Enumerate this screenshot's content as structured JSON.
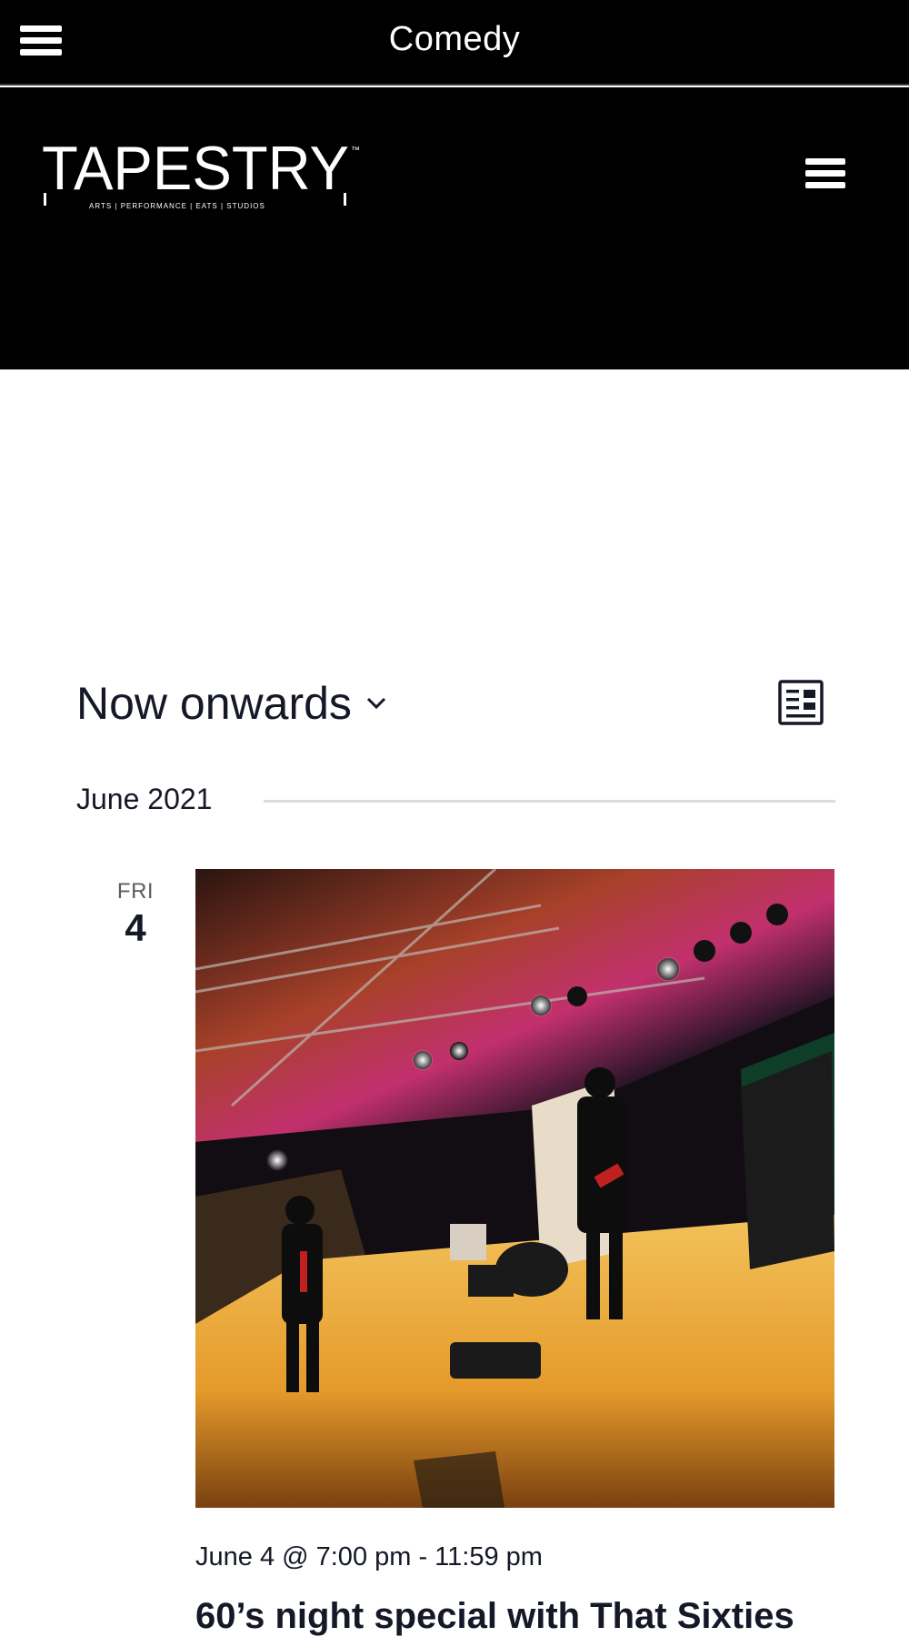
{
  "topbar": {
    "title": "Comedy"
  },
  "header": {
    "logo_text": "TAPESTRY",
    "logo_tagline": "ARTS | PERFORMANCE | EATS | STUDIOS",
    "logo_tm": "™"
  },
  "events_bar": {
    "date_selector_label": "Now onwards",
    "chevron_icon": "chevron-down-icon",
    "view_icon": "list-view-icon"
  },
  "month_separator": {
    "label": "June 2021"
  },
  "event": {
    "day_of_week": "FRI",
    "day_number": "4",
    "time": "June 4 @ 7:00 pm - 11:59 pm",
    "title": "60’s night special with That Sixties",
    "image_icon": "band-on-stage-photo"
  }
}
